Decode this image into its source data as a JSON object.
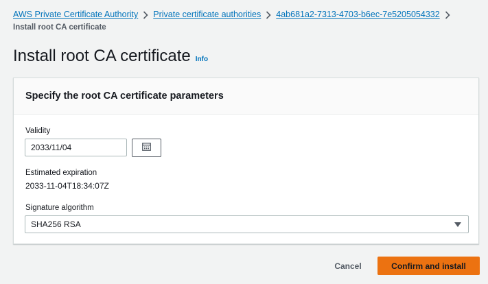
{
  "breadcrumb": {
    "items": [
      {
        "label": "AWS Private Certificate Authority"
      },
      {
        "label": "Private certificate authorities"
      },
      {
        "label": "4ab681a2-7313-4703-b6ec-7e5205054332"
      }
    ],
    "current": "Install root CA certificate"
  },
  "header": {
    "title": "Install root CA certificate",
    "info_label": "Info"
  },
  "form": {
    "section_title": "Specify the root CA certificate parameters",
    "validity": {
      "label": "Validity",
      "value": "2033/11/04",
      "calendar_icon": "calendar-icon"
    },
    "expiration": {
      "label": "Estimated expiration",
      "value": "2033-11-04T18:34:07Z"
    },
    "signature_algorithm": {
      "label": "Signature algorithm",
      "selected": "SHA256 RSA",
      "dropdown_icon": "caret-down-icon"
    }
  },
  "actions": {
    "cancel_label": "Cancel",
    "confirm_label": "Confirm and install"
  },
  "colors": {
    "link": "#0073bb",
    "primary_button": "#ec7211",
    "background": "#f2f3f3"
  }
}
